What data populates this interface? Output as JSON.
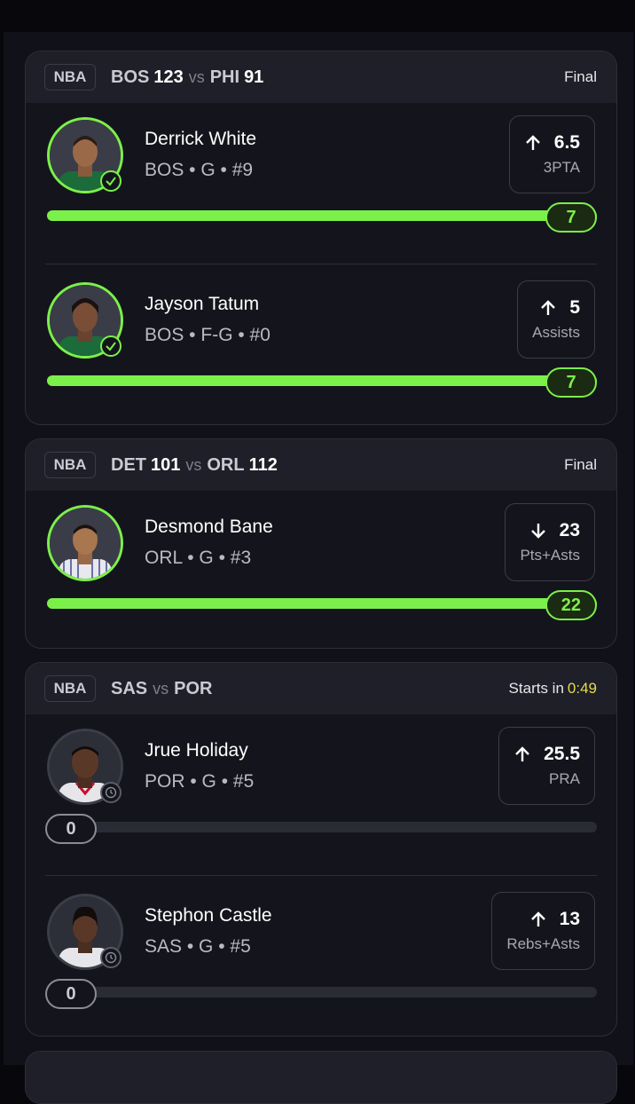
{
  "games": [
    {
      "league": "NBA",
      "home": "BOS",
      "home_score": "123",
      "vs": "vs",
      "away": "PHI",
      "away_score": "91",
      "status": "Final",
      "timer": "",
      "players": [
        {
          "name": "Derrick White",
          "meta": "BOS • G • #9",
          "direction": "up",
          "line": "6.5",
          "stat": "3PTA",
          "result": "7",
          "progress": 1.0,
          "state": "complete",
          "jersey": "green"
        },
        {
          "name": "Jayson Tatum",
          "meta": "BOS • F-G • #0",
          "direction": "up",
          "line": "5",
          "stat": "Assists",
          "result": "7",
          "progress": 1.0,
          "state": "complete",
          "jersey": "green"
        }
      ]
    },
    {
      "league": "NBA",
      "home": "DET",
      "home_score": "101",
      "vs": "vs",
      "away": "ORL",
      "away_score": "112",
      "status": "Final",
      "timer": "",
      "players": [
        {
          "name": "Desmond Bane",
          "meta": "ORL • G • #3",
          "direction": "down",
          "line": "23",
          "stat": "Pts+Asts",
          "result": "22",
          "progress": 1.0,
          "state": "complete",
          "jersey": "pinstripe"
        }
      ]
    },
    {
      "league": "NBA",
      "home": "SAS",
      "home_score": "",
      "vs": "vs",
      "away": "POR",
      "away_score": "",
      "status": "Starts in",
      "timer": "0:49",
      "players": [
        {
          "name": "Jrue Holiday",
          "meta": "POR • G • #5",
          "direction": "up",
          "line": "25.5",
          "stat": "PRA",
          "result": "0",
          "progress": 0.0,
          "state": "pending",
          "jersey": "white"
        },
        {
          "name": "Stephon Castle",
          "meta": "SAS • G • #5",
          "direction": "up",
          "line": "13",
          "stat": "Rebs+Asts",
          "result": "0",
          "progress": 0.0,
          "state": "pending",
          "jersey": "white"
        }
      ]
    }
  ],
  "icons": {
    "up": "arrow-up-icon",
    "down": "arrow-down-icon",
    "check": "check-icon",
    "clock": "clock-icon"
  },
  "colors": {
    "accent": "#7cf04a",
    "timer": "#e6dc4a",
    "card": "#14151c",
    "header": "#1e1f28"
  }
}
